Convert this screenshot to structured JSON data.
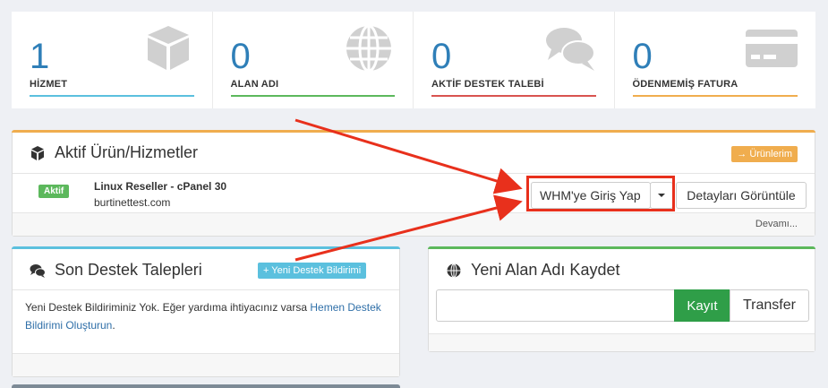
{
  "stats": [
    {
      "number": "1",
      "label": "HİZMET",
      "color": "#5bc0de",
      "icon": "cube-icon"
    },
    {
      "number": "0",
      "label": "ALAN ADI",
      "color": "#5cb85c",
      "icon": "globe-icon"
    },
    {
      "number": "0",
      "label": "AKTİF DESTEK TALEBİ",
      "color": "#d9534f",
      "icon": "comments-icon"
    },
    {
      "number": "0",
      "label": "ÖDENMEMİŞ FATURA",
      "color": "#f0ad4e",
      "icon": "credit-card-icon"
    }
  ],
  "products_panel": {
    "title": "Aktif Ürün/Hizmetler",
    "header_button": "→ Ürünlerim",
    "status": "Aktif",
    "product_name": "Linux Reseller - cPanel 30",
    "domain": "burtinettest.com",
    "login_button": "WHM'ye Giriş Yap",
    "details_button": "Detayları Görüntüle",
    "more_link": "Devamı..."
  },
  "tickets_panel": {
    "title": "Son Destek Talepleri",
    "new_ticket_button": "+ Yeni Destek Bildirimi",
    "empty_text": "Yeni Destek Bildiriminiz Yok. Eğer yardıma ihtiyacınız varsa",
    "empty_link": "Hemen Destek Bildirimi Oluşturun",
    "empty_end": "."
  },
  "domain_panel": {
    "title": "Yeni Alan Adı Kaydet",
    "input_value": "",
    "register_button": "Kayıt",
    "transfer_button": "Transfer"
  },
  "colors": {
    "accent_blue": "#2f7fb8",
    "products_top": "#f0ad4e",
    "tickets_top": "#5bc0de",
    "domain_top": "#5cb85c",
    "annotation_red": "#e8301c"
  }
}
